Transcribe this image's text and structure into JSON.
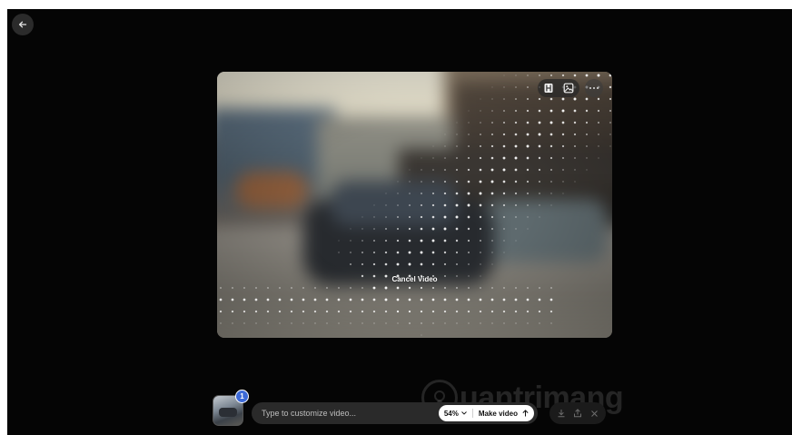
{
  "header": {
    "back_icon": "arrow-left-icon"
  },
  "video": {
    "cancel_label": "Cancel Video",
    "toolbar_icons": [
      "video-frames-icon",
      "image-icon",
      "more-horizontal-icon"
    ]
  },
  "watermark": {
    "text": "uantrimang"
  },
  "composer": {
    "thumbnail_badge": "1",
    "prompt_placeholder": "Type to customize video...",
    "progress_label": "54%",
    "progress": 0.54,
    "make_video_label": "Make video"
  },
  "actions": {
    "icons": [
      "download-icon",
      "share-icon",
      "close-icon"
    ]
  },
  "colors": {
    "background": "#050505",
    "badge": "#3c69d6",
    "controls_bg": "#ffffff"
  }
}
